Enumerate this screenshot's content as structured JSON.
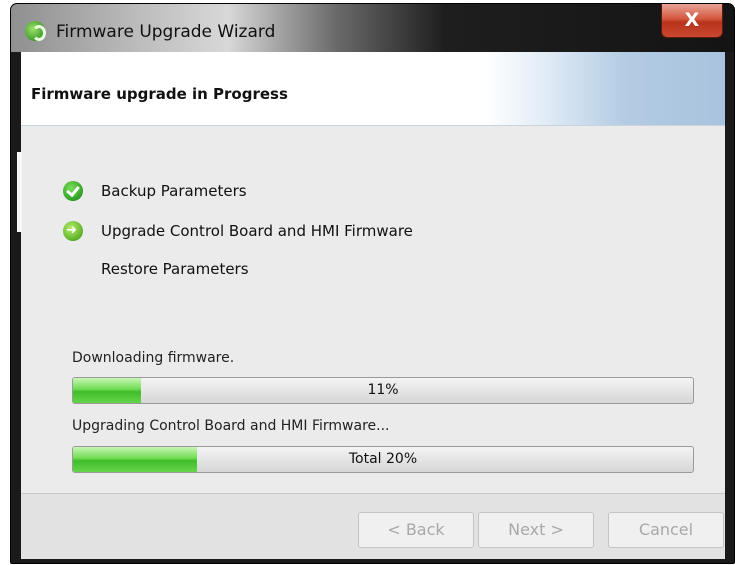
{
  "window": {
    "title": "Firmware Upgrade Wizard",
    "close_label": "X"
  },
  "header": {
    "title": "Firmware upgrade in Progress"
  },
  "steps": [
    {
      "label": "Backup Parameters",
      "state": "done",
      "icon": "check-icon"
    },
    {
      "label": "Upgrade Control Board and HMI Firmware",
      "state": "current",
      "icon": "arrow-right-icon"
    },
    {
      "label": "Restore Parameters",
      "state": "pending",
      "icon": ""
    }
  ],
  "progress": [
    {
      "status": "Downloading firmware.",
      "label": "11%",
      "percent": 11
    },
    {
      "status": "Upgrading Control Board and HMI Firmware...",
      "label": "Total 20%",
      "percent": 20
    }
  ],
  "buttons": {
    "back": "< Back",
    "next": "Next >",
    "cancel": "Cancel"
  },
  "colors": {
    "progress_green": "#3fbd2a",
    "close_red": "#c9482f",
    "header_blue": "#a9c3de"
  }
}
